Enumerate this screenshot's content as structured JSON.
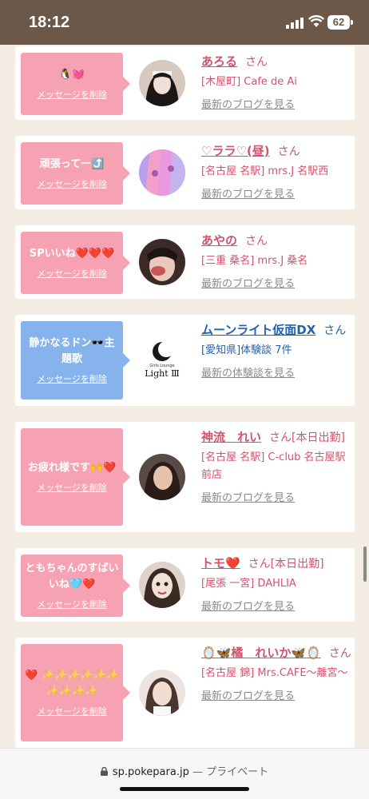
{
  "status": {
    "time": "18:12",
    "battery": "62"
  },
  "colors": {
    "pink": "#f6a2b2",
    "blue": "#87b3ec",
    "name_pink": "#d2536e",
    "name_blue": "#1e62b0"
  },
  "delete_label": "メッセージを削除",
  "san_label": "さん",
  "cards": [
    {
      "message": "🐧💓",
      "name": "あろる",
      "san": "さん",
      "shop": "[木屋町] Cafe de Ai",
      "link": "最新のブログを見る"
    },
    {
      "message": "頑張ってー⤴️",
      "name": "♡ララ♡(昼)",
      "san": "さん",
      "shop": "[名古屋 名駅] mrs.J 名駅西",
      "link": "最新のブログを見る"
    },
    {
      "message": "SPいいね❤️❤️❤️",
      "name": "あやの",
      "san": "さん",
      "shop": "[三重 桑名] mrs.J 桑名",
      "link": "最新のブログを見る"
    },
    {
      "message": "静かなるドン🕶️主題歌",
      "name": "ムーンライト仮面DX",
      "san": "さん",
      "shop": "[愛知県]体験談 7件",
      "link": "最新の体験談を見る",
      "logo_text": "Light Ⅲ",
      "logo_sub": "Girls Lounge"
    },
    {
      "message": "お疲れ様です🙌❤️",
      "name": "神流　れい",
      "san": "さん[本日出勤]",
      "shop": "[名古屋 名駅] C-club 名古屋駅前店",
      "link": "最新のブログを見る"
    },
    {
      "message": "ともちゃんのすばいいね🩵❤️",
      "name": "トモ❤️",
      "san": "さん[本日出勤]",
      "shop": "[尾張 一宮] DAHLIA",
      "link": "最新のブログを見る"
    },
    {
      "message": "❤️ ✨✨✨✨✨✨ ✨✨✨✨",
      "name": "🪞🦋橘　れいか🦋🪞",
      "san": "さん",
      "shop": "[名古屋 錦] Mrs.CAFE〜離宮〜",
      "link": "最新のブログを見る"
    }
  ],
  "browser": {
    "url": "sp.pokepara.jp",
    "privacy": "— プライベート"
  }
}
